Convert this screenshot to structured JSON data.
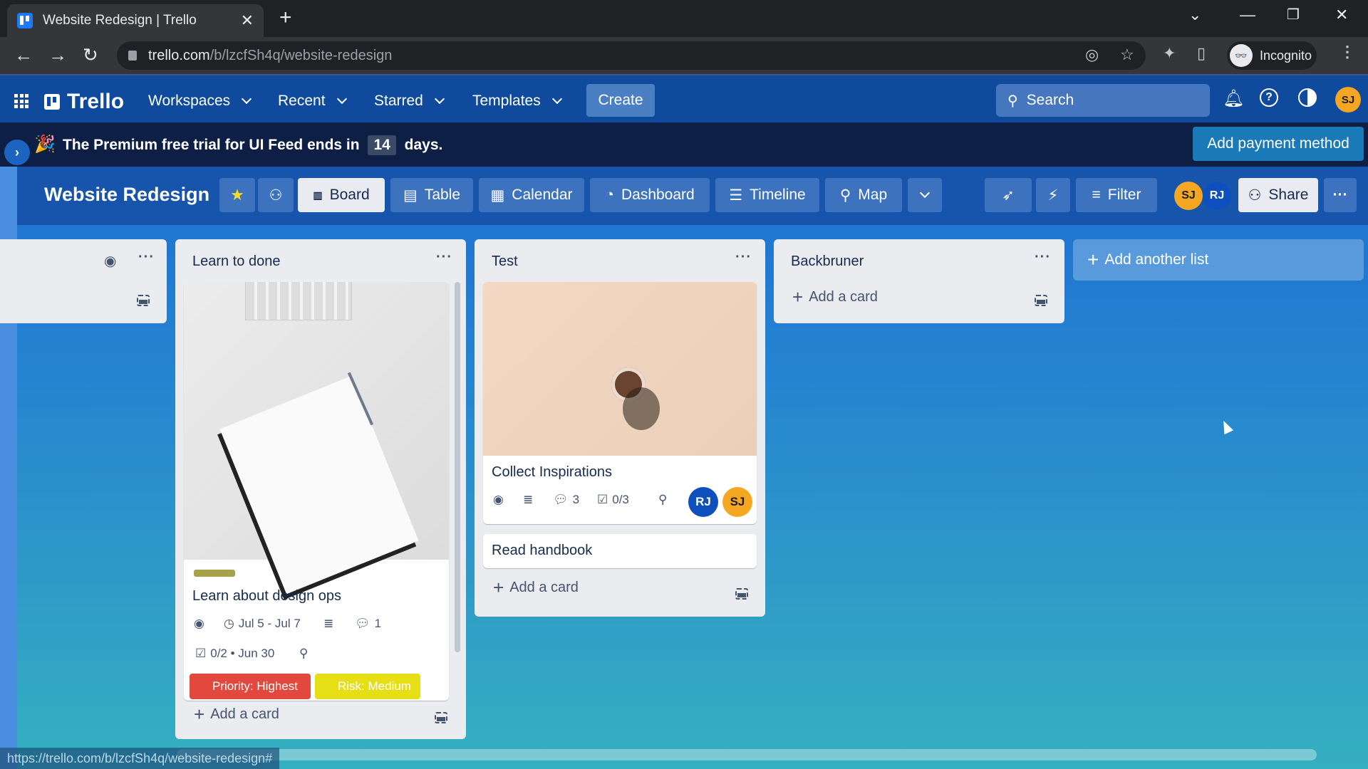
{
  "browser": {
    "tab_title": "Website Redesign | Trello",
    "url_host": "trello.com",
    "url_path": "/b/lzcfSh4q/website-redesign",
    "profile_label": "Incognito",
    "status_url": "https://trello.com/b/lzcfSh4q/website-redesign#"
  },
  "header": {
    "logo": "Trello",
    "nav": [
      {
        "label": "Workspaces"
      },
      {
        "label": "Recent"
      },
      {
        "label": "Starred"
      },
      {
        "label": "Templates"
      }
    ],
    "create_label": "Create",
    "search_placeholder": "Search",
    "user_initials": "SJ"
  },
  "banner": {
    "text_before": "The Premium free trial for UI Feed ends in",
    "days": "14",
    "text_after": "days.",
    "payment_button": "Add payment method"
  },
  "board": {
    "title": "Website Redesign",
    "views": [
      {
        "label": "Board",
        "icon": "board-icon",
        "active": true
      },
      {
        "label": "Table",
        "icon": "table-icon"
      },
      {
        "label": "Calendar",
        "icon": "calendar-icon"
      },
      {
        "label": "Dashboard",
        "icon": "dashboard-icon"
      },
      {
        "label": "Timeline",
        "icon": "timeline-icon"
      },
      {
        "label": "Map",
        "icon": "map-pin-icon"
      }
    ],
    "filter_label": "Filter",
    "members": [
      {
        "initials": "SJ",
        "color": "#f5a623"
      },
      {
        "initials": "RJ",
        "color": "#0c4fbd"
      }
    ],
    "share_label": "Share"
  },
  "lists": [
    {
      "title": "",
      "add_card": ""
    },
    {
      "title": "Learn to done",
      "add_card": "Add a card",
      "cards": [
        {
          "title": "Learn about design ops",
          "dates": "Jul 5 - Jul 7",
          "comments": "1",
          "checklist": "0/2 • Jun 30",
          "labels": [
            {
              "text": "Priority: Highest",
              "color": "#e2483d"
            },
            {
              "text": "Risk: Medium",
              "color": "#e6df16"
            }
          ]
        }
      ]
    },
    {
      "title": "Test",
      "add_card": "Add a card",
      "cards": [
        {
          "title": "Collect Inspirations",
          "comments": "3",
          "checklist": "0/3",
          "members": [
            {
              "initials": "RJ",
              "color": "#0c4fbd"
            },
            {
              "initials": "SJ",
              "color": "#f5a623"
            }
          ]
        },
        {
          "title": "Read handbook"
        }
      ]
    },
    {
      "title": "Backbruner",
      "add_card": "Add a card"
    }
  ],
  "add_list_label": "Add another list"
}
